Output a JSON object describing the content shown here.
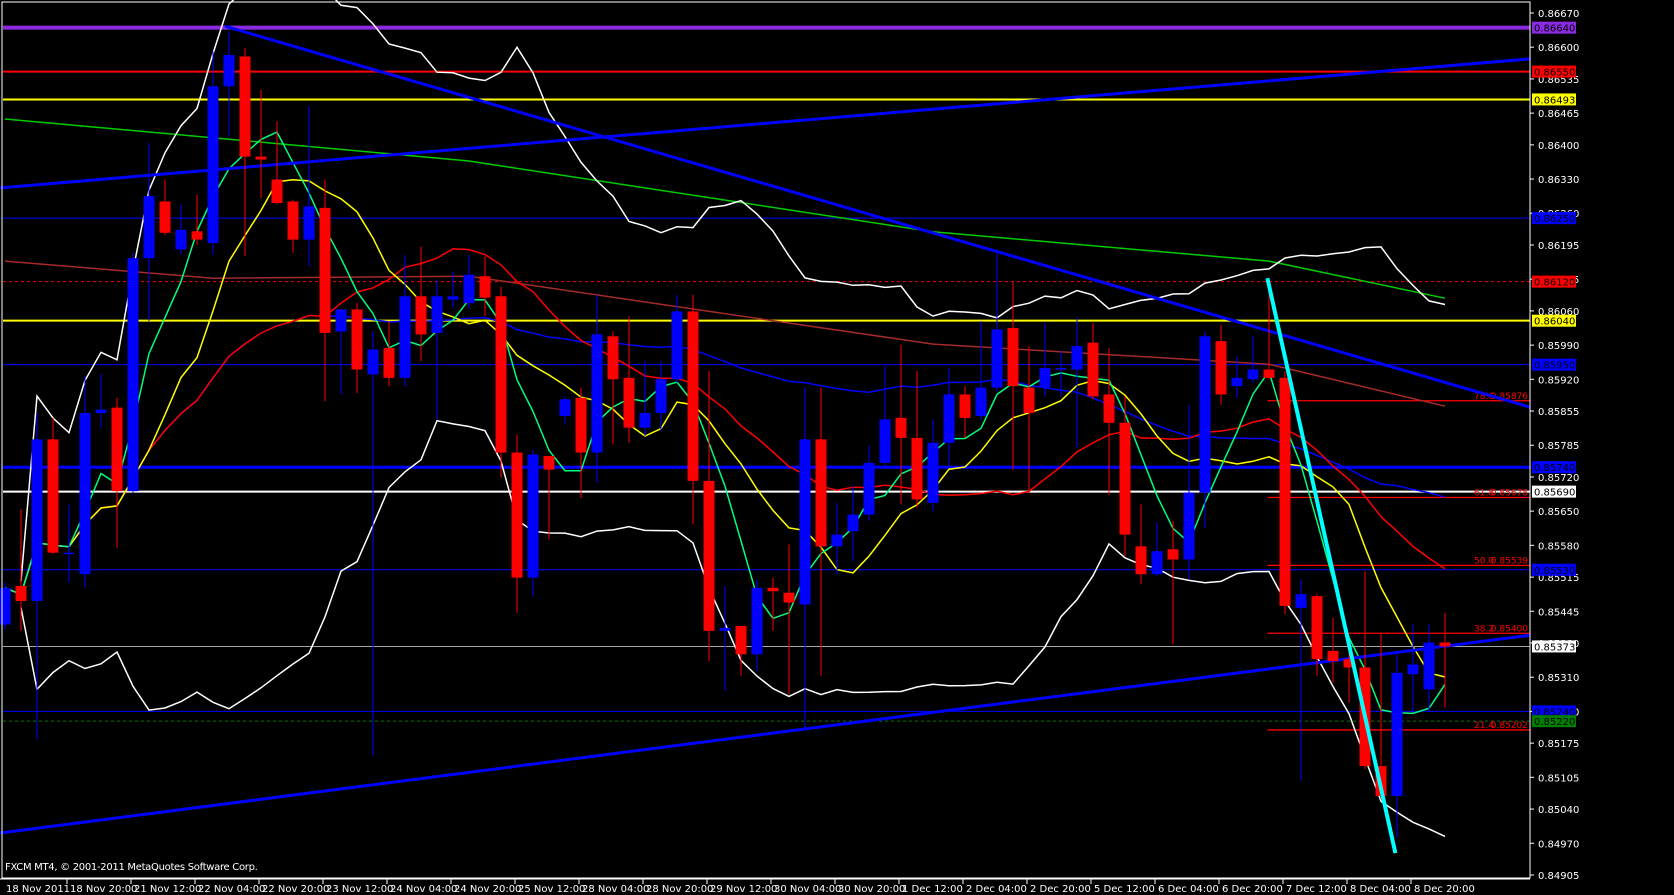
{
  "window": {
    "copyright": "FXCM MT4, © 2001-2011 MetaQuotes Software Corp."
  },
  "colors": {
    "bull": "#0000ff",
    "bear": "#ff0000",
    "background": "#000000",
    "axis": "#ffffff"
  },
  "chart_data": {
    "type": "candlestick",
    "symbol_period": "H4",
    "ylim": [
      0.84905,
      0.8667
    ],
    "price_ticks": [
      "0.86670",
      "0.86600",
      "0.86535",
      "0.86465",
      "0.86400",
      "0.86330",
      "0.86260",
      "0.86195",
      "0.86125",
      "0.86060",
      "0.85990",
      "0.85920",
      "0.85855",
      "0.85785",
      "0.85720",
      "0.85650",
      "0.85580",
      "0.85515",
      "0.85445",
      "0.85380",
      "0.85310",
      "0.85240",
      "0.85175",
      "0.85105",
      "0.85040",
      "0.84970",
      "0.84905"
    ],
    "time_labels": [
      {
        "bar": 0,
        "label": "18 Nov 2011"
      },
      {
        "bar": 4,
        "label": "18 Nov 20:00"
      },
      {
        "bar": 8,
        "label": "21 Nov 12:00"
      },
      {
        "bar": 12,
        "label": "22 Nov 04:00"
      },
      {
        "bar": 16,
        "label": "22 Nov 20:00"
      },
      {
        "bar": 20,
        "label": "23 Nov 12:00"
      },
      {
        "bar": 24,
        "label": "24 Nov 04:00"
      },
      {
        "bar": 28,
        "label": "24 Nov 20:00"
      },
      {
        "bar": 32,
        "label": "25 Nov 12:00"
      },
      {
        "bar": 36,
        "label": "28 Nov 04:00"
      },
      {
        "bar": 40,
        "label": "28 Nov 20:00"
      },
      {
        "bar": 44,
        "label": "29 Nov 12:00"
      },
      {
        "bar": 48,
        "label": "30 Nov 04:00"
      },
      {
        "bar": 52,
        "label": "30 Nov 20:00"
      },
      {
        "bar": 56,
        "label": "1 Dec 12:00"
      },
      {
        "bar": 60,
        "label": "2 Dec 04:00"
      },
      {
        "bar": 64,
        "label": "2 Dec 20:00"
      },
      {
        "bar": 68,
        "label": "5 Dec 12:00"
      },
      {
        "bar": 72,
        "label": "6 Dec 04:00"
      },
      {
        "bar": 76,
        "label": "6 Dec 20:00"
      },
      {
        "bar": 80,
        "label": "7 Dec 12:00"
      },
      {
        "bar": 84,
        "label": "8 Dec 04:00"
      },
      {
        "bar": 88,
        "label": "8 Dec 20:00"
      }
    ],
    "ohlc_fields": [
      "open",
      "high",
      "low",
      "close"
    ],
    "candles": [
      [
        0.85418,
        0.85504,
        0.85408,
        0.85493
      ],
      [
        0.85497,
        0.85654,
        0.85405,
        0.85466
      ],
      [
        0.85466,
        0.85851,
        0.85183,
        0.85797
      ],
      [
        0.85797,
        0.85841,
        0.85562,
        0.85565
      ],
      [
        0.85562,
        0.85664,
        0.85504,
        0.85565
      ],
      [
        0.85521,
        0.85926,
        0.85493,
        0.85851
      ],
      [
        0.85851,
        0.8593,
        0.85821,
        0.85858
      ],
      [
        0.85862,
        0.85882,
        0.85575,
        0.85691
      ],
      [
        0.85691,
        0.86179,
        0.85688,
        0.86168
      ],
      [
        0.86168,
        0.86404,
        0.86039,
        0.86295
      ],
      [
        0.86284,
        0.86329,
        0.86216,
        0.8622
      ],
      [
        0.86186,
        0.86278,
        0.86175,
        0.86226
      ],
      [
        0.86223,
        0.86298,
        0.86196,
        0.86206
      ],
      [
        0.86199,
        0.86591,
        0.86175,
        0.8652
      ],
      [
        0.8652,
        0.86632,
        0.86417,
        0.86584
      ],
      [
        0.86581,
        0.86598,
        0.86172,
        0.86376
      ],
      [
        0.86376,
        0.86513,
        0.86291,
        0.8637
      ],
      [
        0.86329,
        0.86448,
        0.86278,
        0.86281
      ],
      [
        0.86284,
        0.86288,
        0.86179,
        0.86206
      ],
      [
        0.86206,
        0.86479,
        0.86151,
        0.86274
      ],
      [
        0.86271,
        0.86329,
        0.85875,
        0.86015
      ],
      [
        0.86018,
        0.86063,
        0.85889,
        0.86063
      ],
      [
        0.86063,
        0.86076,
        0.85892,
        0.8594
      ],
      [
        0.8593,
        0.86018,
        0.85149,
        0.85981
      ],
      [
        0.85984,
        0.86039,
        0.85906,
        0.85923
      ],
      [
        0.85923,
        0.86175,
        0.85906,
        0.8609
      ],
      [
        0.8609,
        0.86192,
        0.85957,
        0.86012
      ],
      [
        0.86015,
        0.86124,
        0.85838,
        0.8609
      ],
      [
        0.86083,
        0.86141,
        0.86066,
        0.8609
      ],
      [
        0.86076,
        0.86175,
        0.86066,
        0.86134
      ],
      [
        0.86131,
        0.86172,
        0.86049,
        0.86087
      ],
      [
        0.8609,
        0.8611,
        0.85718,
        0.8577
      ],
      [
        0.8577,
        0.85807,
        0.85442,
        0.85514
      ],
      [
        0.85514,
        0.85776,
        0.85476,
        0.85766
      ],
      [
        0.85763,
        0.85763,
        0.85592,
        0.85735
      ],
      [
        0.85845,
        0.85885,
        0.85827,
        0.85879
      ],
      [
        0.85882,
        0.85903,
        0.85677,
        0.8577
      ],
      [
        0.8577,
        0.86093,
        0.85708,
        0.86012
      ],
      [
        0.86008,
        0.86018,
        0.85787,
        0.8592
      ],
      [
        0.85923,
        0.86049,
        0.8579,
        0.85821
      ],
      [
        0.85821,
        0.85957,
        0.85804,
        0.85851
      ],
      [
        0.85851,
        0.85957,
        0.85814,
        0.8592
      ],
      [
        0.8592,
        0.86093,
        0.85913,
        0.86059
      ],
      [
        0.86059,
        0.86093,
        0.85623,
        0.85712
      ],
      [
        0.85712,
        0.85937,
        0.85343,
        0.85405
      ],
      [
        0.85405,
        0.85497,
        0.85282,
        0.85411
      ],
      [
        0.85415,
        0.85415,
        0.85313,
        0.85357
      ],
      [
        0.85357,
        0.8551,
        0.85323,
        0.85493
      ],
      [
        0.85493,
        0.85514,
        0.85405,
        0.85486
      ],
      [
        0.85483,
        0.85582,
        0.85275,
        0.85463
      ],
      [
        0.85459,
        0.85903,
        0.85203,
        0.85797
      ],
      [
        0.85797,
        0.85903,
        0.85313,
        0.85578
      ],
      [
        0.85578,
        0.85667,
        0.85521,
        0.85602
      ],
      [
        0.85609,
        0.85701,
        0.85548,
        0.85643
      ],
      [
        0.85643,
        0.85783,
        0.8563,
        0.85749
      ],
      [
        0.85749,
        0.85947,
        0.85742,
        0.85838
      ],
      [
        0.85841,
        0.85991,
        0.85664,
        0.858
      ],
      [
        0.858,
        0.85937,
        0.85657,
        0.85674
      ],
      [
        0.85667,
        0.85838,
        0.8565,
        0.8579
      ],
      [
        0.8579,
        0.85943,
        0.85742,
        0.85889
      ],
      [
        0.85889,
        0.85906,
        0.858,
        0.85841
      ],
      [
        0.85845,
        0.86039,
        0.85838,
        0.85903
      ],
      [
        0.85903,
        0.86186,
        0.85896,
        0.86022
      ],
      [
        0.86025,
        0.86121,
        0.85735,
        0.85906
      ],
      [
        0.85903,
        0.85988,
        0.85688,
        0.85851
      ],
      [
        0.85903,
        0.86035,
        0.85885,
        0.85943
      ],
      [
        0.8594,
        0.85978,
        0.85885,
        0.85943
      ],
      [
        0.8594,
        0.86046,
        0.8578,
        0.85988
      ],
      [
        0.85995,
        0.86035,
        0.85879,
        0.85885
      ],
      [
        0.85889,
        0.85984,
        0.85684,
        0.85831
      ],
      [
        0.85831,
        0.85885,
        0.85558,
        0.85602
      ],
      [
        0.85578,
        0.85664,
        0.855,
        0.85521
      ],
      [
        0.85521,
        0.85626,
        0.85517,
        0.85568
      ],
      [
        0.85572,
        0.8563,
        0.85377,
        0.85551
      ],
      [
        0.85551,
        0.85868,
        0.8551,
        0.85688
      ],
      [
        0.85688,
        0.86018,
        0.85616,
        0.86008
      ],
      [
        0.85998,
        0.86032,
        0.85868,
        0.85889
      ],
      [
        0.85906,
        0.85967,
        0.85882,
        0.85923
      ],
      [
        0.8592,
        0.86008,
        0.85913,
        0.8594
      ],
      [
        0.8594,
        0.86124,
        0.8592,
        0.85923
      ],
      [
        0.85923,
        0.85937,
        0.85439,
        0.85456
      ],
      [
        0.85452,
        0.8551,
        0.85098,
        0.8548
      ],
      [
        0.85476,
        0.8548,
        0.85313,
        0.85347
      ],
      [
        0.85364,
        0.85432,
        0.85299,
        0.85343
      ],
      [
        0.85347,
        0.8536,
        0.85258,
        0.8533
      ],
      [
        0.8533,
        0.85527,
        0.85122,
        0.85128
      ],
      [
        0.85128,
        0.85401,
        0.8506,
        0.85067
      ],
      [
        0.85067,
        0.85357,
        0.84982,
        0.85319
      ],
      [
        0.85316,
        0.85418,
        0.85238,
        0.85336
      ],
      [
        0.85285,
        0.85418,
        0.85238,
        0.85381
      ],
      [
        0.85381,
        0.85442,
        0.85248,
        0.85373
      ]
    ],
    "moving_averages": [
      {
        "name": "ma-fast",
        "period": 5,
        "color": "#00ff7f"
      },
      {
        "name": "ma-yellow",
        "period": 10,
        "color": "#ffff00"
      },
      {
        "name": "ma-red",
        "period": 21,
        "color": "#ff0000"
      },
      {
        "name": "ma-blue",
        "period": 55,
        "color": "#0000ff"
      }
    ],
    "bollinger": {
      "period": 20,
      "deviations": 2,
      "color": "#ffffff"
    },
    "long_averages": [
      {
        "name": "ma-green-long",
        "color": "#00cc00",
        "points": [
          [
            0,
            0.86453
          ],
          [
            29,
            0.86367
          ],
          [
            58,
            0.86222
          ],
          [
            79,
            0.86162
          ],
          [
            90,
            0.86086
          ]
        ]
      },
      {
        "name": "ma-brown-long",
        "color": "#a52a2a",
        "points": [
          [
            0,
            0.86162
          ],
          [
            13,
            0.86127
          ],
          [
            29,
            0.86131
          ],
          [
            58,
            0.85992
          ],
          [
            79,
            0.85951
          ],
          [
            90,
            0.85865
          ]
        ]
      }
    ],
    "horizontal_lines": [
      {
        "name": "level-purple",
        "price": 0.8664,
        "label": "0.86640",
        "color": "#8a2be2",
        "width": 4
      },
      {
        "name": "level-red-top",
        "price": 0.8655,
        "label": "0.86550",
        "color": "#ff0000",
        "width": 2
      },
      {
        "name": "level-yellow-top",
        "price": 0.86493,
        "label": "0.86493",
        "color": "#ffff00",
        "width": 2
      },
      {
        "name": "level-blue-1",
        "price": 0.8625,
        "label": "0.86250",
        "color": "#0000ff",
        "width": 1
      },
      {
        "name": "level-red-dashed",
        "price": 0.8612,
        "label": "0.86120",
        "color": "#ff0000",
        "width": 1,
        "dashed": true
      },
      {
        "name": "level-yellow-mid",
        "price": 0.8604,
        "label": "0.86040",
        "color": "#ffff00",
        "width": 2
      },
      {
        "name": "level-blue-2",
        "price": 0.8595,
        "label": "0.85950",
        "color": "#0000ff",
        "width": 1
      },
      {
        "name": "level-blue-thick",
        "price": 0.8574,
        "label": "0.85740",
        "color": "#0000ff",
        "width": 3
      },
      {
        "name": "level-white",
        "price": 0.8569,
        "label": "0.85690",
        "color": "#ffffff",
        "width": 2
      },
      {
        "name": "level-blue-3",
        "price": 0.8553,
        "label": "0.85530",
        "color": "#0000ff",
        "width": 1
      },
      {
        "name": "bid-line",
        "price": 0.85373,
        "label": "0.85373",
        "color": "#a0a8b0",
        "width": 1,
        "label_bg": "#ffffff"
      },
      {
        "name": "level-blue-4",
        "price": 0.8524,
        "label": "0.85240",
        "color": "#0000ff",
        "width": 1
      },
      {
        "name": "level-green-dashed",
        "price": 0.8522,
        "label": "0.85220",
        "color": "#008000",
        "width": 1,
        "dashed": true
      }
    ],
    "trendlines": [
      {
        "name": "trendline-lower-rising",
        "color": "#0000ff",
        "width": 3,
        "from": [
          -0.3,
          0.84991
        ],
        "to": [
          95.3,
          0.85396
        ]
      },
      {
        "name": "trendline-upper-rising",
        "color": "#0000ff",
        "width": 3,
        "from": [
          -0.3,
          0.86312
        ],
        "to": [
          95.3,
          0.86576
        ]
      },
      {
        "name": "trendline-falling",
        "color": "#0000ff",
        "width": 3,
        "from": [
          13.75,
          0.86643
        ],
        "to": [
          95.3,
          0.85863
        ]
      },
      {
        "name": "trendline-cyan",
        "color": "#00ffff",
        "width": 4,
        "from": [
          78.9,
          0.86127
        ],
        "to": [
          86.9,
          0.8495
        ]
      }
    ],
    "fibonacci": {
      "start_bar": 78.9,
      "color": "#ff0000",
      "levels": [
        {
          "ratio": "78.6",
          "price_label": "0.85876",
          "price": 0.85876
        },
        {
          "ratio": "61.8",
          "price_label": "0.85678",
          "price": 0.85678
        },
        {
          "ratio": "50.0",
          "price_label": "0.85539",
          "price": 0.85539
        },
        {
          "ratio": "38.2",
          "price_label": "0.85400",
          "price": 0.854
        },
        {
          "ratio": "21.4",
          "price_label": "0.85202",
          "price": 0.85202
        }
      ]
    }
  }
}
